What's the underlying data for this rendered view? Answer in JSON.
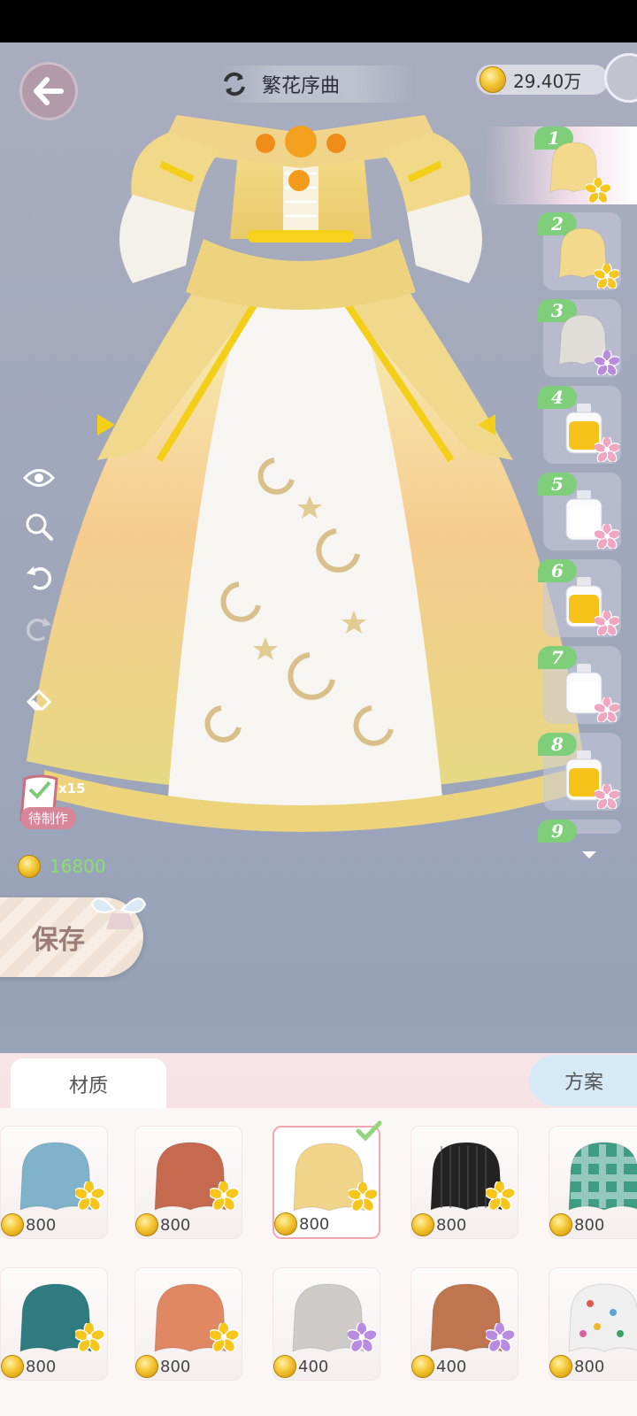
{
  "header": {
    "title": "繁花序曲",
    "currency_amount": "29.40万"
  },
  "left_tools": {
    "craft_count": "x15",
    "craft_pending_label": "待制作",
    "cost": "16800"
  },
  "save_button": {
    "label": "保存"
  },
  "variants": [
    {
      "num": "1",
      "kind": "fabric",
      "color": "#f3d98c",
      "flower": "gold"
    },
    {
      "num": "2",
      "kind": "fabric",
      "color": "#f3d98c",
      "flower": "gold"
    },
    {
      "num": "3",
      "kind": "fabric",
      "color": "#e0ddd8",
      "flower": "purple"
    },
    {
      "num": "4",
      "kind": "bottle",
      "color": "#f6c21a",
      "flower": "pink"
    },
    {
      "num": "5",
      "kind": "bottle",
      "color": "#ffffff",
      "flower": "pink"
    },
    {
      "num": "6",
      "kind": "bottle",
      "color": "#f6c21a",
      "flower": "pink"
    },
    {
      "num": "7",
      "kind": "bottle",
      "color": "#ffffff",
      "flower": "pink"
    },
    {
      "num": "8",
      "kind": "bottle",
      "color": "#f6c21a",
      "flower": "pink"
    },
    {
      "num": "9",
      "kind": "bottle",
      "color": "#f6c21a",
      "flower": "pink"
    }
  ],
  "tabs": {
    "material": "材质",
    "scheme": "方案"
  },
  "materials": [
    {
      "price": "800",
      "color": "#7fb3cc",
      "flower": "gold"
    },
    {
      "price": "800",
      "color": "#c5694f",
      "flower": "gold"
    },
    {
      "price": "800",
      "color": "#efd48a",
      "flower": "gold",
      "selected": true
    },
    {
      "price": "800",
      "color": "#222222",
      "flower": "gold",
      "pattern": "stripe"
    },
    {
      "price": "800",
      "color": "#3d9c82",
      "flower": "",
      "pattern": "plaid"
    },
    {
      "price": "800",
      "color": "#2e7c80",
      "flower": "gold"
    },
    {
      "price": "800",
      "color": "#e08764",
      "flower": "gold"
    },
    {
      "price": "400",
      "color": "#cfcbc8",
      "flower": "purple"
    },
    {
      "price": "400",
      "color": "#bf7650",
      "flower": "purple"
    },
    {
      "price": "800",
      "color": "#efefef",
      "flower": "",
      "pattern": "dots"
    }
  ],
  "icons": {
    "back": "back-arrow-icon",
    "swap": "swap-icon",
    "eye": "eye-icon",
    "zoom": "zoom-icon",
    "undo": "undo-icon",
    "redo": "redo-icon",
    "eraser": "eraser-icon"
  }
}
